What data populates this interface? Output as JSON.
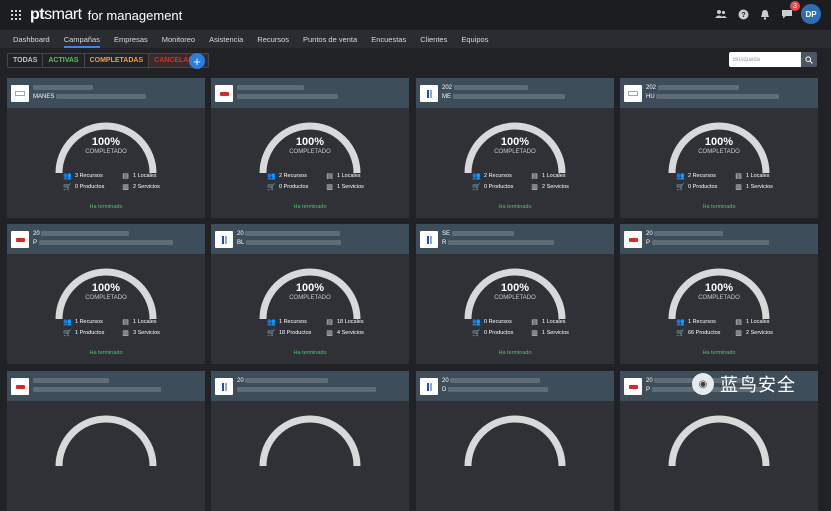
{
  "app": {
    "brand_pt": "pt",
    "brand_smart": "smart",
    "brand_sub": "for management",
    "notif_count": "3",
    "avatar": "DP"
  },
  "nav": [
    "Dashboard",
    "Campañas",
    "Empresas",
    "Monitoreo",
    "Asistencia",
    "Recursos",
    "Puntos de venta",
    "Encuestas",
    "Clientes",
    "Equipos"
  ],
  "filters": {
    "todas": "TODAS",
    "activas": "ACTIVAS",
    "completadas": "COMPLETADAS",
    "canceladas": "CANCELADAS"
  },
  "search": {
    "placeholder": "Búsqueda"
  },
  "cards": [
    {
      "logo": "gray",
      "line1": "",
      "line2": "MANES",
      "pct": "100%",
      "label": "COMPLETADO",
      "recursos": "3 Recursos",
      "locales": "1 Locales",
      "productos": "0 Productos",
      "servicios": "2 Servicios",
      "status": "Ha terminado"
    },
    {
      "logo": "red",
      "line1": "",
      "line2": "",
      "pct": "100%",
      "label": "COMPLETADO",
      "recursos": "2 Recursos",
      "locales": "1 Locales",
      "productos": "0 Productos",
      "servicios": "1 Servicios",
      "status": "Ha terminado"
    },
    {
      "logo": "blue",
      "line1": "202",
      "line2": "ME",
      "pct": "100%",
      "label": "COMPLETADO",
      "recursos": "2 Recursos",
      "locales": "1 Locales",
      "productos": "0 Productos",
      "servicios": "2 Servicios",
      "status": "Ha terminado"
    },
    {
      "logo": "gray",
      "line1": "202",
      "line2": "HU",
      "pct": "100%",
      "label": "COMPLETADO",
      "recursos": "2 Recursos",
      "locales": "1 Locales",
      "productos": "0 Productos",
      "servicios": "1 Servicios",
      "status": "Ha terminado"
    },
    {
      "logo": "red",
      "line1": "20",
      "line2": "P",
      "pct": "100%",
      "label": "COMPLETADO",
      "recursos": "1 Recursos",
      "locales": "1 Locales",
      "productos": "1 Productos",
      "servicios": "3 Servicios",
      "status": "Ha terminado"
    },
    {
      "logo": "blue",
      "line1": "20",
      "line2": "BL",
      "pct": "100%",
      "label": "COMPLETADO",
      "recursos": "1 Recursos",
      "locales": "18 Locales",
      "productos": "18 Productos",
      "servicios": "4 Servicios",
      "status": "Ha terminado"
    },
    {
      "logo": "blue",
      "line1": "SE",
      "line2": "R",
      "pct": "100%",
      "label": "COMPLETADO",
      "recursos": "0 Recursos",
      "locales": "1 Locales",
      "productos": "0 Productos",
      "servicios": "1 Servicios",
      "status": "Ha terminado"
    },
    {
      "logo": "red",
      "line1": "20",
      "line2": "P",
      "pct": "100%",
      "label": "COMPLETADO",
      "recursos": "1 Recursos",
      "locales": "1 Locales",
      "productos": "66 Productos",
      "servicios": "2 Servicios",
      "status": "Ha terminado"
    },
    {
      "logo": "red",
      "line1": "",
      "line2": "",
      "pct": "",
      "label": "",
      "recursos": "",
      "locales": "",
      "productos": "",
      "servicios": "",
      "status": ""
    },
    {
      "logo": "blue",
      "line1": "20",
      "line2": "",
      "pct": "",
      "label": "",
      "recursos": "",
      "locales": "",
      "productos": "",
      "servicios": "",
      "status": ""
    },
    {
      "logo": "blue",
      "line1": "20",
      "line2": "D",
      "pct": "",
      "label": "",
      "recursos": "",
      "locales": "",
      "productos": "",
      "servicios": "",
      "status": ""
    },
    {
      "logo": "red",
      "line1": "20",
      "line2": "P",
      "pct": "",
      "label": "",
      "recursos": "",
      "locales": "",
      "productos": "",
      "servicios": "",
      "status": ""
    }
  ],
  "watermark": "蓝鸟安全",
  "colors": {
    "accent": "#2d7de0",
    "done": "#4fc36a",
    "card_head": "#3e4d5a",
    "card_body": "#2f3136"
  }
}
